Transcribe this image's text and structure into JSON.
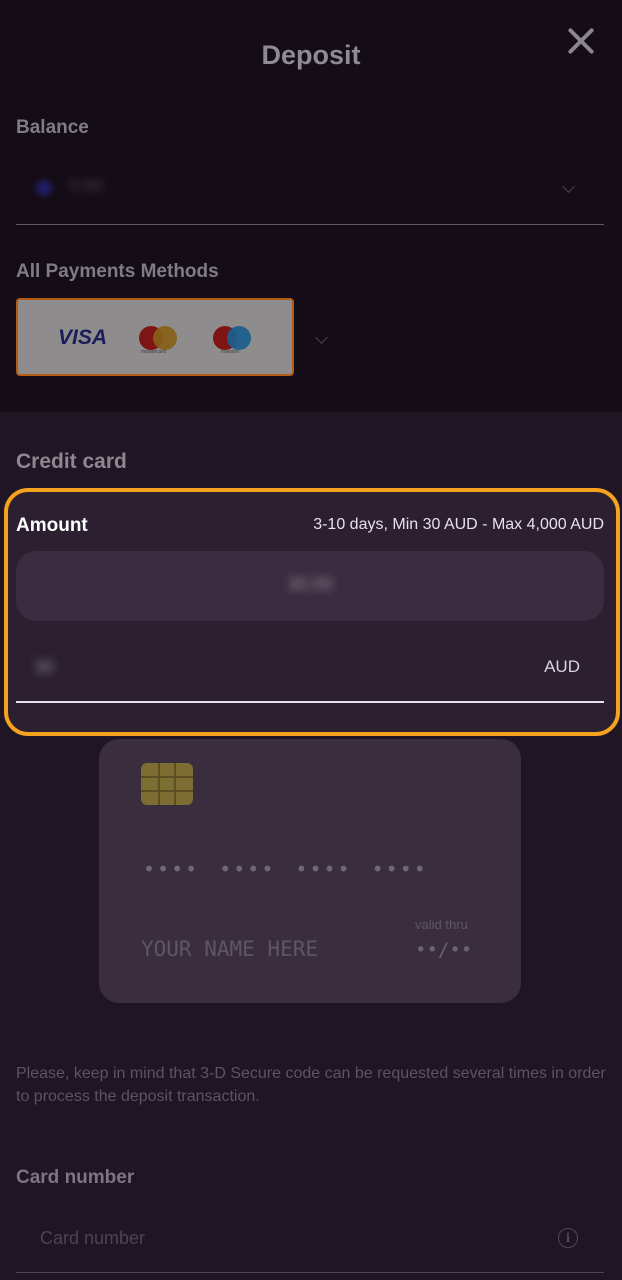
{
  "header": {
    "title": "Deposit"
  },
  "balance": {
    "label": "Balance",
    "value": "0.00"
  },
  "payment_methods": {
    "label": "All Payments Methods",
    "logos": [
      "VISA",
      "mastercard",
      "maestro"
    ]
  },
  "credit_card": {
    "section_title": "Credit card",
    "amount_label": "Amount",
    "amount_limits": "3-10 days, Min 30 AUD - Max 4,000 AUD",
    "preset_value": "30.00",
    "amount_value": "30",
    "currency": "AUD"
  },
  "card_visual": {
    "number_mask": "•••• •••• •••• ••••",
    "name_placeholder": "YOUR NAME HERE",
    "valid_thru_label": "valid thru",
    "expiry_mask": "••/••"
  },
  "notice": "Please, keep in mind that 3-D Secure code can be requested several times in order to process the deposit transaction.",
  "card_number": {
    "label": "Card number",
    "placeholder": "Card number"
  },
  "colors": {
    "highlight": "#f5a21e",
    "background": "#1c1220"
  },
  "icons": [
    "close-icon",
    "chevron-down-icon",
    "chip-icon",
    "info-icon"
  ]
}
